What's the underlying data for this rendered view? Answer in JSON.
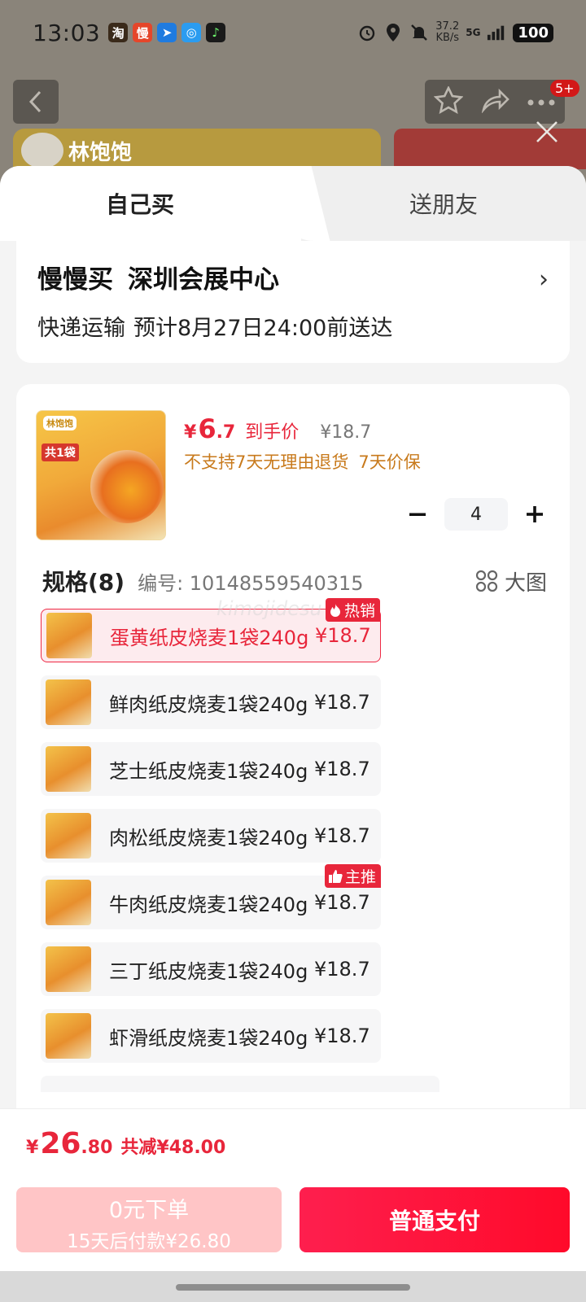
{
  "status_bar": {
    "time": "13:03",
    "net_speed_value": "37.2",
    "net_speed_unit": "KB/s",
    "network": "5G",
    "battery": "100",
    "app_icons": [
      "taobao-icon",
      "manman-icon",
      "app-blue-icon",
      "chat-icon",
      "music-icon"
    ]
  },
  "background_page": {
    "brand_logo": "林饱饱",
    "notification_count": "5+"
  },
  "sheet": {
    "tabs": [
      {
        "label": "自己买",
        "selected": true
      },
      {
        "label": "送朋友",
        "selected": false
      }
    ],
    "address": {
      "service": "慢慢买",
      "location": "深圳会展中心",
      "delivery": "快递运输",
      "eta": "预计8月27日24:00前送达"
    },
    "product": {
      "price_symbol": "¥",
      "price_int": "6",
      "price_dec": ".7",
      "price_label": "到手价",
      "original_price": "¥18.7",
      "policy_return": "不支持7天无理由退货",
      "policy_price": "7天价保",
      "quantity": "4",
      "thumb_logo": "林饱饱",
      "thumb_tag": "共1袋"
    },
    "spec": {
      "title": "规格(8)",
      "code": "编号: 10148559540315",
      "view_big": "大图",
      "items": [
        {
          "name": "蛋黄纸皮烧麦1袋240g",
          "price": "¥18.7",
          "badge": "热销",
          "selected": true
        },
        {
          "name": "鲜肉纸皮烧麦1袋240g",
          "price": "¥18.7",
          "badge": "",
          "selected": false
        },
        {
          "name": "芝士纸皮烧麦1袋240g",
          "price": "¥18.7",
          "badge": "",
          "selected": false
        },
        {
          "name": "肉松纸皮烧麦1袋240g",
          "price": "¥18.7",
          "badge": "",
          "selected": false
        },
        {
          "name": "牛肉纸皮烧麦1袋240g",
          "price": "¥18.7",
          "badge": "主推",
          "selected": false
        },
        {
          "name": "三丁纸皮烧麦1袋240g",
          "price": "¥18.7",
          "badge": "",
          "selected": false
        },
        {
          "name": "虾滑纸皮烧麦1袋240g",
          "price": "¥18.7",
          "badge": "",
          "selected": false
        }
      ]
    },
    "watermark": "kimojidesu"
  },
  "footer": {
    "total_symbol": "¥",
    "total_int": "26",
    "total_dec": ".80",
    "savings": "共减¥48.00",
    "zero_order_label": "0元下单",
    "zero_order_sub": "15天后付款¥26.80",
    "pay_label": "普通支付"
  },
  "colors": {
    "accent": "#e8263b",
    "policy": "#c87a1c",
    "pay_button": "#ff0a2a",
    "zero_button": "#ffc5c6"
  }
}
